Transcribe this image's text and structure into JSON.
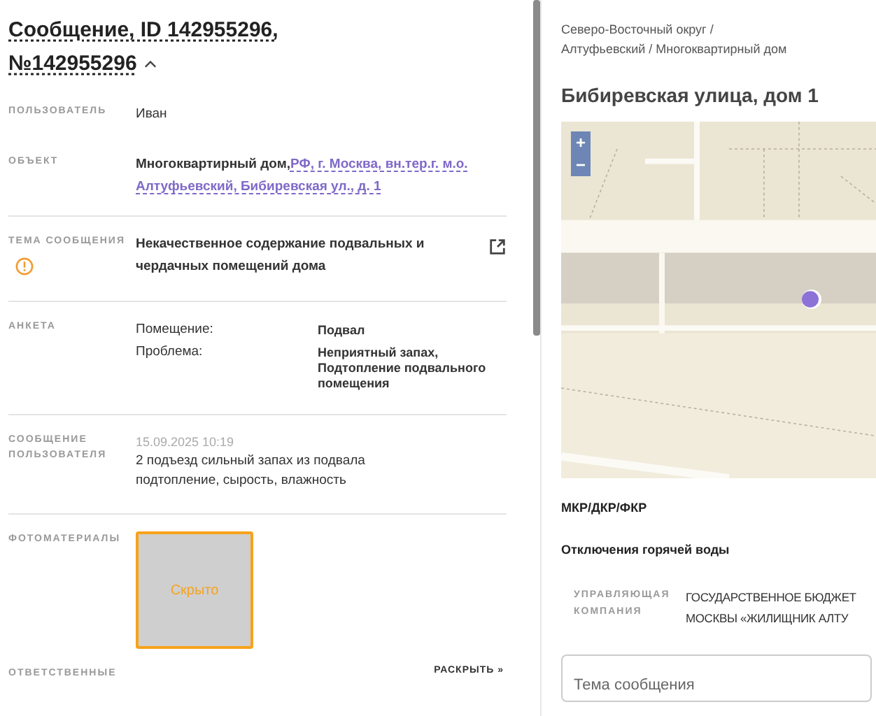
{
  "message": {
    "title_lines": [
      "Сообщение, ID 142955296,",
      "№142955296"
    ],
    "expanded": true
  },
  "fields": [
    {
      "kind": "text",
      "label": "ПОЛЬЗОВАТЕЛЬ",
      "value": "Иван"
    },
    {
      "kind": "object",
      "label": "ОБЪЕКТ",
      "object_type": "Многоквартирный дом,",
      "address_lines": [
        "РФ, г. Москва, вн.тер.г. м.о.",
        "Алтуфьевский, Бибиревская ул., д. 1"
      ]
    },
    {
      "kind": "topic",
      "label": "ТЕМА СООБЩЕНИЯ",
      "value": "Некачественное содержание подвальных и чердачных помещений дома",
      "warning": true
    },
    {
      "kind": "survey",
      "label": "АНКЕТА",
      "rows": [
        {
          "key": "Помещение:",
          "value": "Подвал"
        },
        {
          "key": "Проблема:",
          "value": "Неприятный запах, Подтопление подвального помещения"
        }
      ]
    },
    {
      "kind": "message",
      "label": "СООБЩЕНИЕ ПОЛЬЗОВАТЕЛЯ",
      "date": "15.09.2025 10:19",
      "lines": [
        "2 подъезд сильный запах из подвала",
        "подтопление, сырость, влажность"
      ]
    },
    {
      "kind": "photos",
      "label": "ФОТОМАТЕРИАЛЫ",
      "photos": [
        {
          "label": "Скрыто"
        }
      ]
    },
    {
      "kind": "collapsed",
      "label": "ОТВЕТСТВЕННЫЕ",
      "action": "РАСКРЫТЬ »"
    }
  ],
  "location": {
    "breadcrumb": "Северо-Восточный округ / Алтуфьевский / Многоквартирный дом",
    "title": "Бибиревская улица, дом 1",
    "map": {
      "kind": "picture",
      "zoom_in": "+",
      "zoom_out": "−"
    }
  },
  "sections": [
    "МКР/ДКР/ФКР",
    "Отключения горячей воды"
  ],
  "management": {
    "label": "УПРАВЛЯЮЩАЯ КОМПАНИЯ",
    "lines": [
      "ГОСУДАРСТВЕННОЕ БЮДЖЕТ",
      "МОСКВЫ «ЖИЛИЩНИК АЛТУ"
    ]
  },
  "topic_field": {
    "placeholder": "Тема сообщения"
  }
}
